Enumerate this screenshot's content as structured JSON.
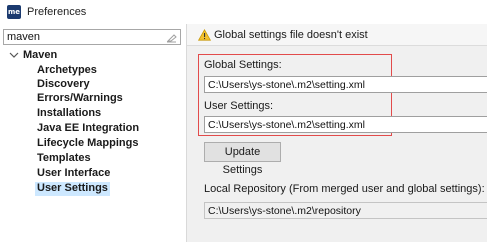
{
  "window": {
    "title": "Preferences",
    "app_icon_text": "me"
  },
  "filter": {
    "value": "maven"
  },
  "tree": {
    "root": "Maven",
    "items": [
      {
        "label": "Archetypes"
      },
      {
        "label": "Discovery"
      },
      {
        "label": "Errors/Warnings"
      },
      {
        "label": "Installations"
      },
      {
        "label": "Java EE Integration"
      },
      {
        "label": "Lifecycle Mappings"
      },
      {
        "label": "Templates"
      },
      {
        "label": "User Interface"
      },
      {
        "label": "User Settings",
        "selected": true
      }
    ]
  },
  "main": {
    "banner": "Global settings file doesn't exist",
    "global_settings_label": "Global Settings:",
    "global_settings_value": "C:\\Users\\ys-stone\\.m2\\setting.xml",
    "user_settings_label": "User Settings:",
    "user_settings_value": "C:\\Users\\ys-stone\\.m2\\setting.xml",
    "update_button": "Update Settings",
    "local_repo_label": "Local Repository (From merged user and global settings):",
    "local_repo_value": "C:\\Users\\ys-stone\\.m2\\repository"
  },
  "colors": {
    "highlight_box": "#e24b4b",
    "selection": "#cde8ff",
    "warning": "#f2c12e"
  }
}
